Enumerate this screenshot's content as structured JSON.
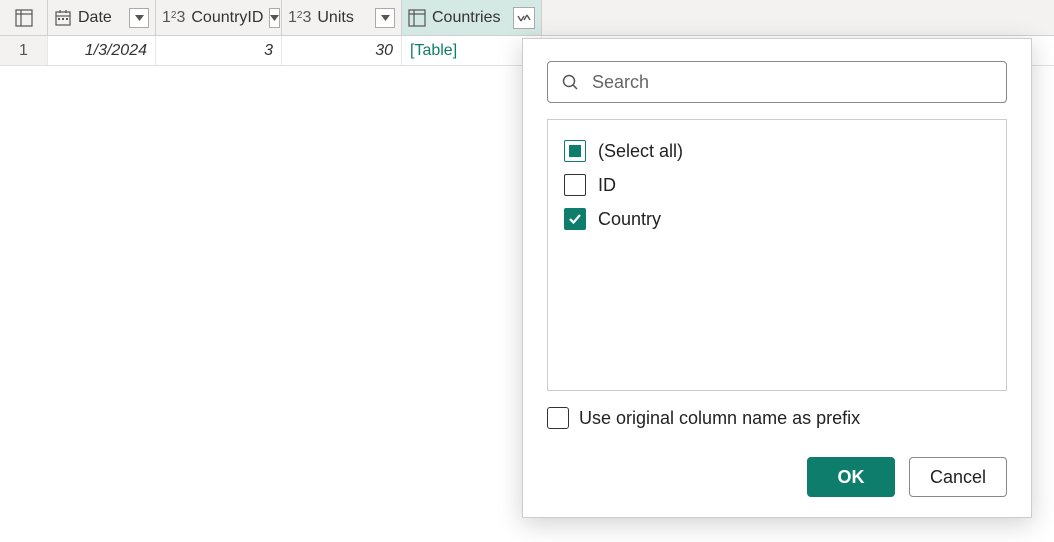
{
  "columns": {
    "date": "Date",
    "countryId": "CountryID",
    "units": "Units",
    "countries": "Countries"
  },
  "row": {
    "index": "1",
    "date": "1/3/2024",
    "countryId": "3",
    "units": "30",
    "countries": "[Table]"
  },
  "popup": {
    "searchPlaceholder": "Search",
    "items": {
      "selectAll": "(Select all)",
      "id": "ID",
      "country": "Country"
    },
    "prefixLabel": "Use original column name as prefix",
    "ok": "OK",
    "cancel": "Cancel"
  }
}
